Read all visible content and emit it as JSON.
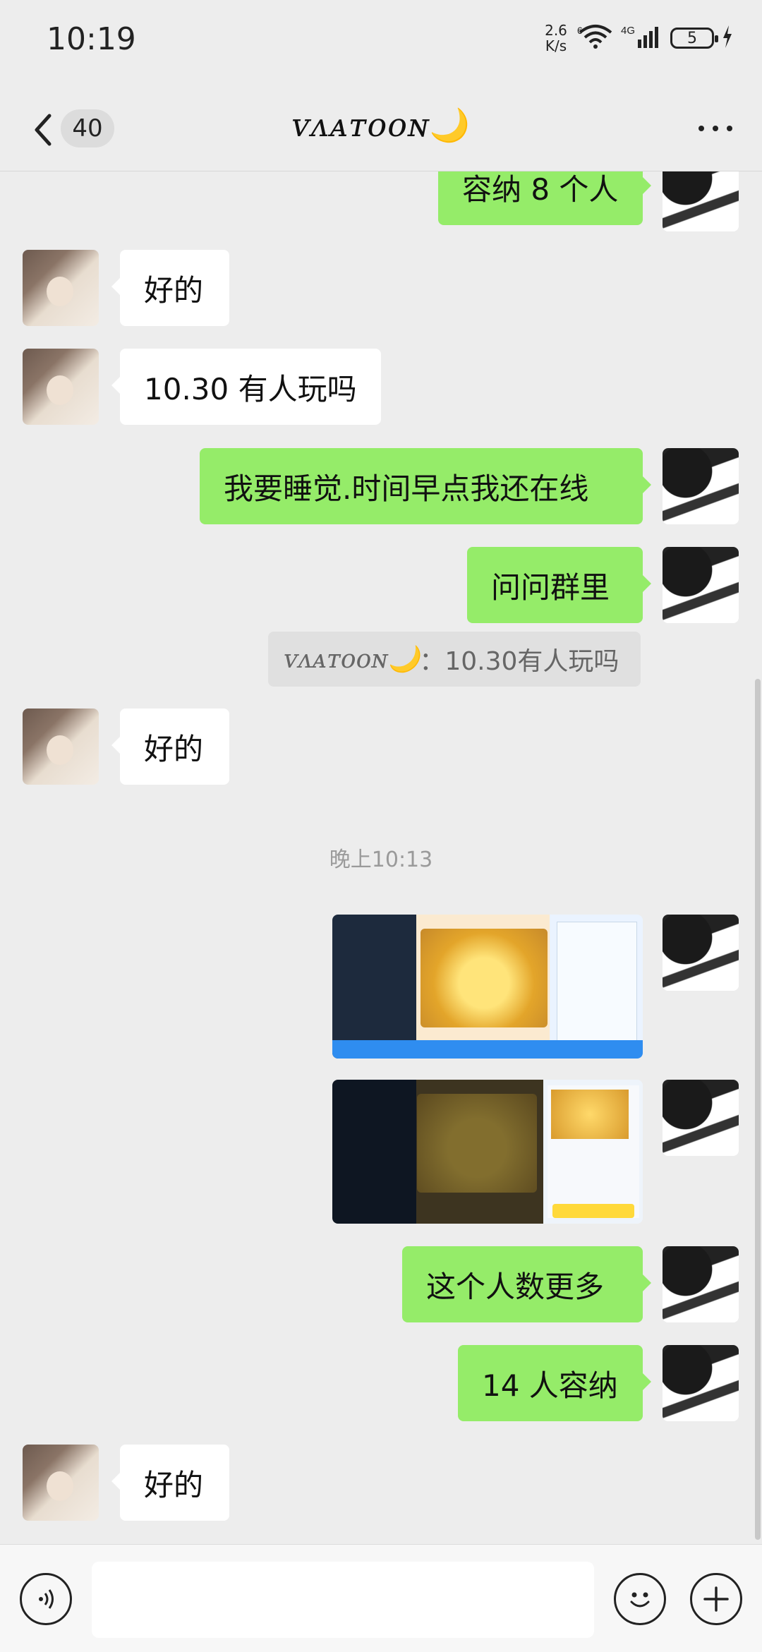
{
  "status_bar": {
    "time": "10:19",
    "net_speed_value": "2.6",
    "net_speed_unit": "K/s",
    "wifi_label": "6",
    "signal_label": "4G",
    "battery": "5"
  },
  "header": {
    "back_count": "40",
    "contact_name": "ᴠᴧᴀᴛᴏᴏɴ",
    "contact_moon": "🌙"
  },
  "messages": [
    {
      "side": "right",
      "type": "text",
      "text": "容纳 8 个人"
    },
    {
      "side": "left",
      "type": "text",
      "text": "好的"
    },
    {
      "side": "left",
      "type": "text",
      "text": "10.30 有人玩吗"
    },
    {
      "side": "right",
      "type": "text",
      "text": "我要睡觉.时间早点我还在线"
    },
    {
      "side": "right",
      "type": "text",
      "text": "问问群里"
    },
    {
      "side": "right",
      "type": "quote",
      "name": "ᴠᴧᴀᴛᴏᴏɴ🌙",
      "text": "：10.30有人玩吗"
    },
    {
      "side": "left",
      "type": "text",
      "text": "好的"
    },
    {
      "type": "time",
      "text": "晚上10:13"
    },
    {
      "side": "right",
      "type": "image",
      "description": "game screenshot 1"
    },
    {
      "side": "right",
      "type": "image",
      "description": "game screenshot 2"
    },
    {
      "side": "right",
      "type": "text",
      "text": "这个人数更多"
    },
    {
      "side": "right",
      "type": "text",
      "text": "14 人容纳"
    },
    {
      "side": "left",
      "type": "text",
      "text": "好的"
    }
  ],
  "icons": {
    "back": "chevron-left-icon",
    "more": "more-dots-icon",
    "voice": "voice-icon",
    "emoji": "emoji-icon",
    "plus": "plus-icon"
  },
  "colors": {
    "background": "#ededed",
    "bubble_self": "#95ec69",
    "bubble_other": "#ffffff"
  }
}
